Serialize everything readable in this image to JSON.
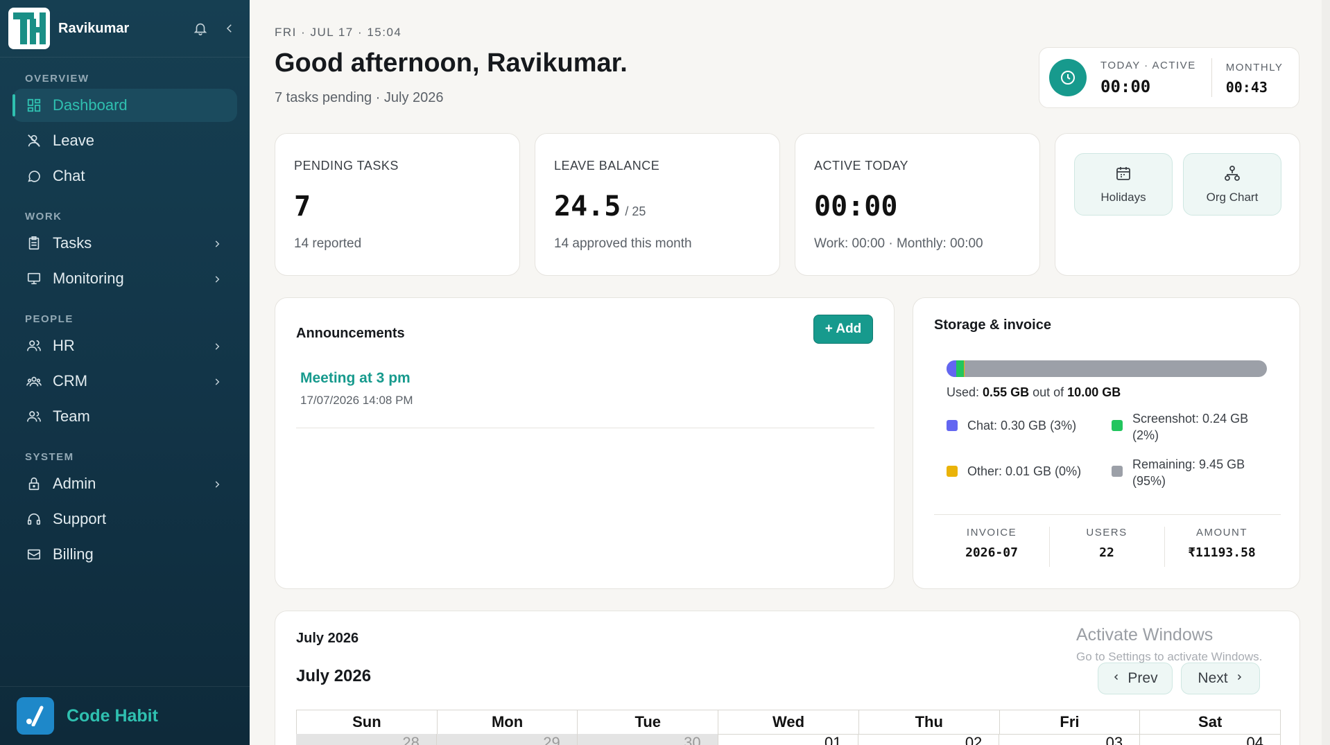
{
  "sidebar": {
    "user_name": "Ravikumar",
    "sections": {
      "overview": "OVERVIEW",
      "work": "WORK",
      "people": "PEOPLE",
      "system": "SYSTEM"
    },
    "items": {
      "dashboard": "Dashboard",
      "leave": "Leave",
      "chat": "Chat",
      "tasks": "Tasks",
      "monitoring": "Monitoring",
      "hr": "HR",
      "crm": "CRM",
      "team": "Team",
      "admin": "Admin",
      "support": "Support",
      "billing": "Billing"
    },
    "footer_brand": "Code Habit",
    "accent": "#2fc0b0"
  },
  "header": {
    "datetime": "FRI · JUL 17 · 15:04",
    "greeting": "Good afternoon, Ravikumar.",
    "subtitle": "7 tasks pending · July 2026"
  },
  "timecard": {
    "today_label": "TODAY · ACTIVE",
    "today_value": "00:00",
    "monthly_label": "MONTHLY",
    "monthly_value": "00:43"
  },
  "stats": {
    "pending": {
      "label": "PENDING TASKS",
      "value": "7",
      "sub": "14 reported"
    },
    "leave": {
      "label": "LEAVE BALANCE",
      "value": "24.5",
      "total": "/ 25",
      "sub": "14 approved this month"
    },
    "active": {
      "label": "ACTIVE TODAY",
      "value": "00:00",
      "sub": "Work: 00:00 · Monthly: 00:00"
    }
  },
  "quick_links": {
    "holidays": "Holidays",
    "org_chart": "Org Chart"
  },
  "announcements": {
    "title": "Announcements",
    "add_label": "+ Add",
    "items": [
      {
        "title": "Meeting at 3 pm",
        "datetime": "17/07/2026 14:08 PM"
      }
    ]
  },
  "storage": {
    "title": "Storage & invoice",
    "used_prefix": "Used:",
    "used_value": "0.55 GB",
    "used_mid": "out of",
    "total_value": "10.00 GB",
    "segments": [
      {
        "name": "Chat",
        "fraction": 0.03,
        "color": "#6366f1"
      },
      {
        "name": "Screenshot",
        "fraction": 0.024,
        "color": "#22c55e"
      },
      {
        "name": "Other",
        "fraction": 0.001,
        "color": "#eab308"
      }
    ],
    "legend": {
      "chat": "Chat: 0.30 GB (3%)",
      "screenshot": "Screenshot: 0.24 GB (2%)",
      "other": "Other: 0.01 GB (0%)",
      "remaining": "Remaining: 9.45 GB (95%)"
    },
    "colors": {
      "chat": "#6366f1",
      "screenshot": "#22c55e",
      "other": "#eab308",
      "remaining": "#9ca0a8"
    },
    "invoice": {
      "invoice_label": "INVOICE",
      "invoice_value": "2026-07",
      "users_label": "USERS",
      "users_value": "22",
      "amount_label": "AMOUNT",
      "amount_value": "₹11193.58"
    }
  },
  "calendar": {
    "title": "July 2026",
    "month_label": "July 2026",
    "prev_label": "Prev",
    "next_label": "Next",
    "weekdays": [
      "Sun",
      "Mon",
      "Tue",
      "Wed",
      "Thu",
      "Fri",
      "Sat"
    ],
    "first_row": [
      "28",
      "29",
      "30",
      "01",
      "02",
      "03",
      "04"
    ]
  },
  "watermark": {
    "line1": "Activate Windows",
    "line2": "Go to Settings to activate Windows."
  }
}
